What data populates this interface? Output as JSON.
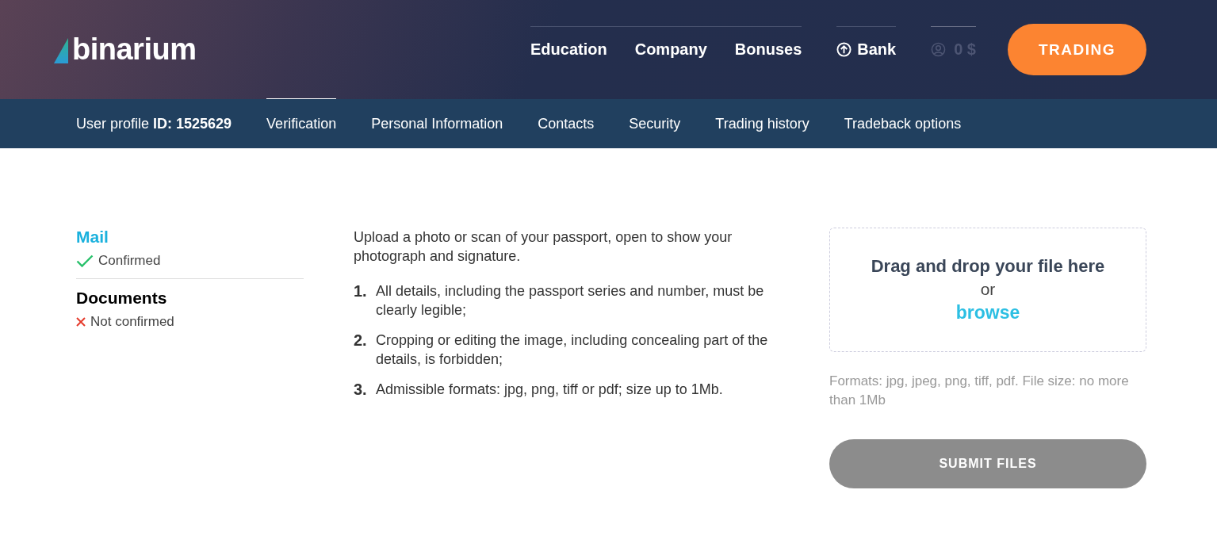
{
  "header": {
    "logo": "binarium",
    "nav": [
      {
        "label": "Education"
      },
      {
        "label": "Company"
      },
      {
        "label": "Bonuses"
      }
    ],
    "bank": {
      "label": "Bank"
    },
    "balance": {
      "label": "0 $",
      "disabled": true
    },
    "trading_button": "TRADING"
  },
  "profile_nav": {
    "user": "User profile **ID: 1525629**",
    "tabs": [
      {
        "label": "Verification",
        "selected": true
      },
      {
        "label": "Personal Information",
        "selected": false
      },
      {
        "label": "Contacts",
        "selected": false
      },
      {
        "label": "Security",
        "selected": false
      },
      {
        "label": "Trading history",
        "selected": false
      },
      {
        "label": "Tradeback options",
        "selected": false
      }
    ]
  },
  "statuses": [
    {
      "title": "Mail",
      "selected": true,
      "confirmed": true,
      "status": "Confirmed"
    },
    {
      "title": "Documents",
      "selected": false,
      "confirmed": false,
      "status": "Not confirmed"
    }
  ],
  "instructions": {
    "intro": "Upload a photo or scan of your passport, open to show your photograph and signature.",
    "items": [
      {
        "number": "1.",
        "text": "All details, including the passport series and number, must be clearly legible;"
      },
      {
        "number": "2.",
        "text": "Cropping or editing the image, including concealing part of the details, is forbidden;"
      },
      {
        "number": "3.",
        "text": "Admissible formats: jpg, png, tiff or pdf; size up to 1Mb."
      }
    ]
  },
  "upload": {
    "drop_title": "Drag and drop your file here",
    "or": "or",
    "browse": "browse",
    "formats": "Formats: jpg, jpeg, png, tiff, pdf. File size: no more than 1Mb",
    "submit": {
      "label": "SUBMIT FILES",
      "disabled": true
    }
  }
}
